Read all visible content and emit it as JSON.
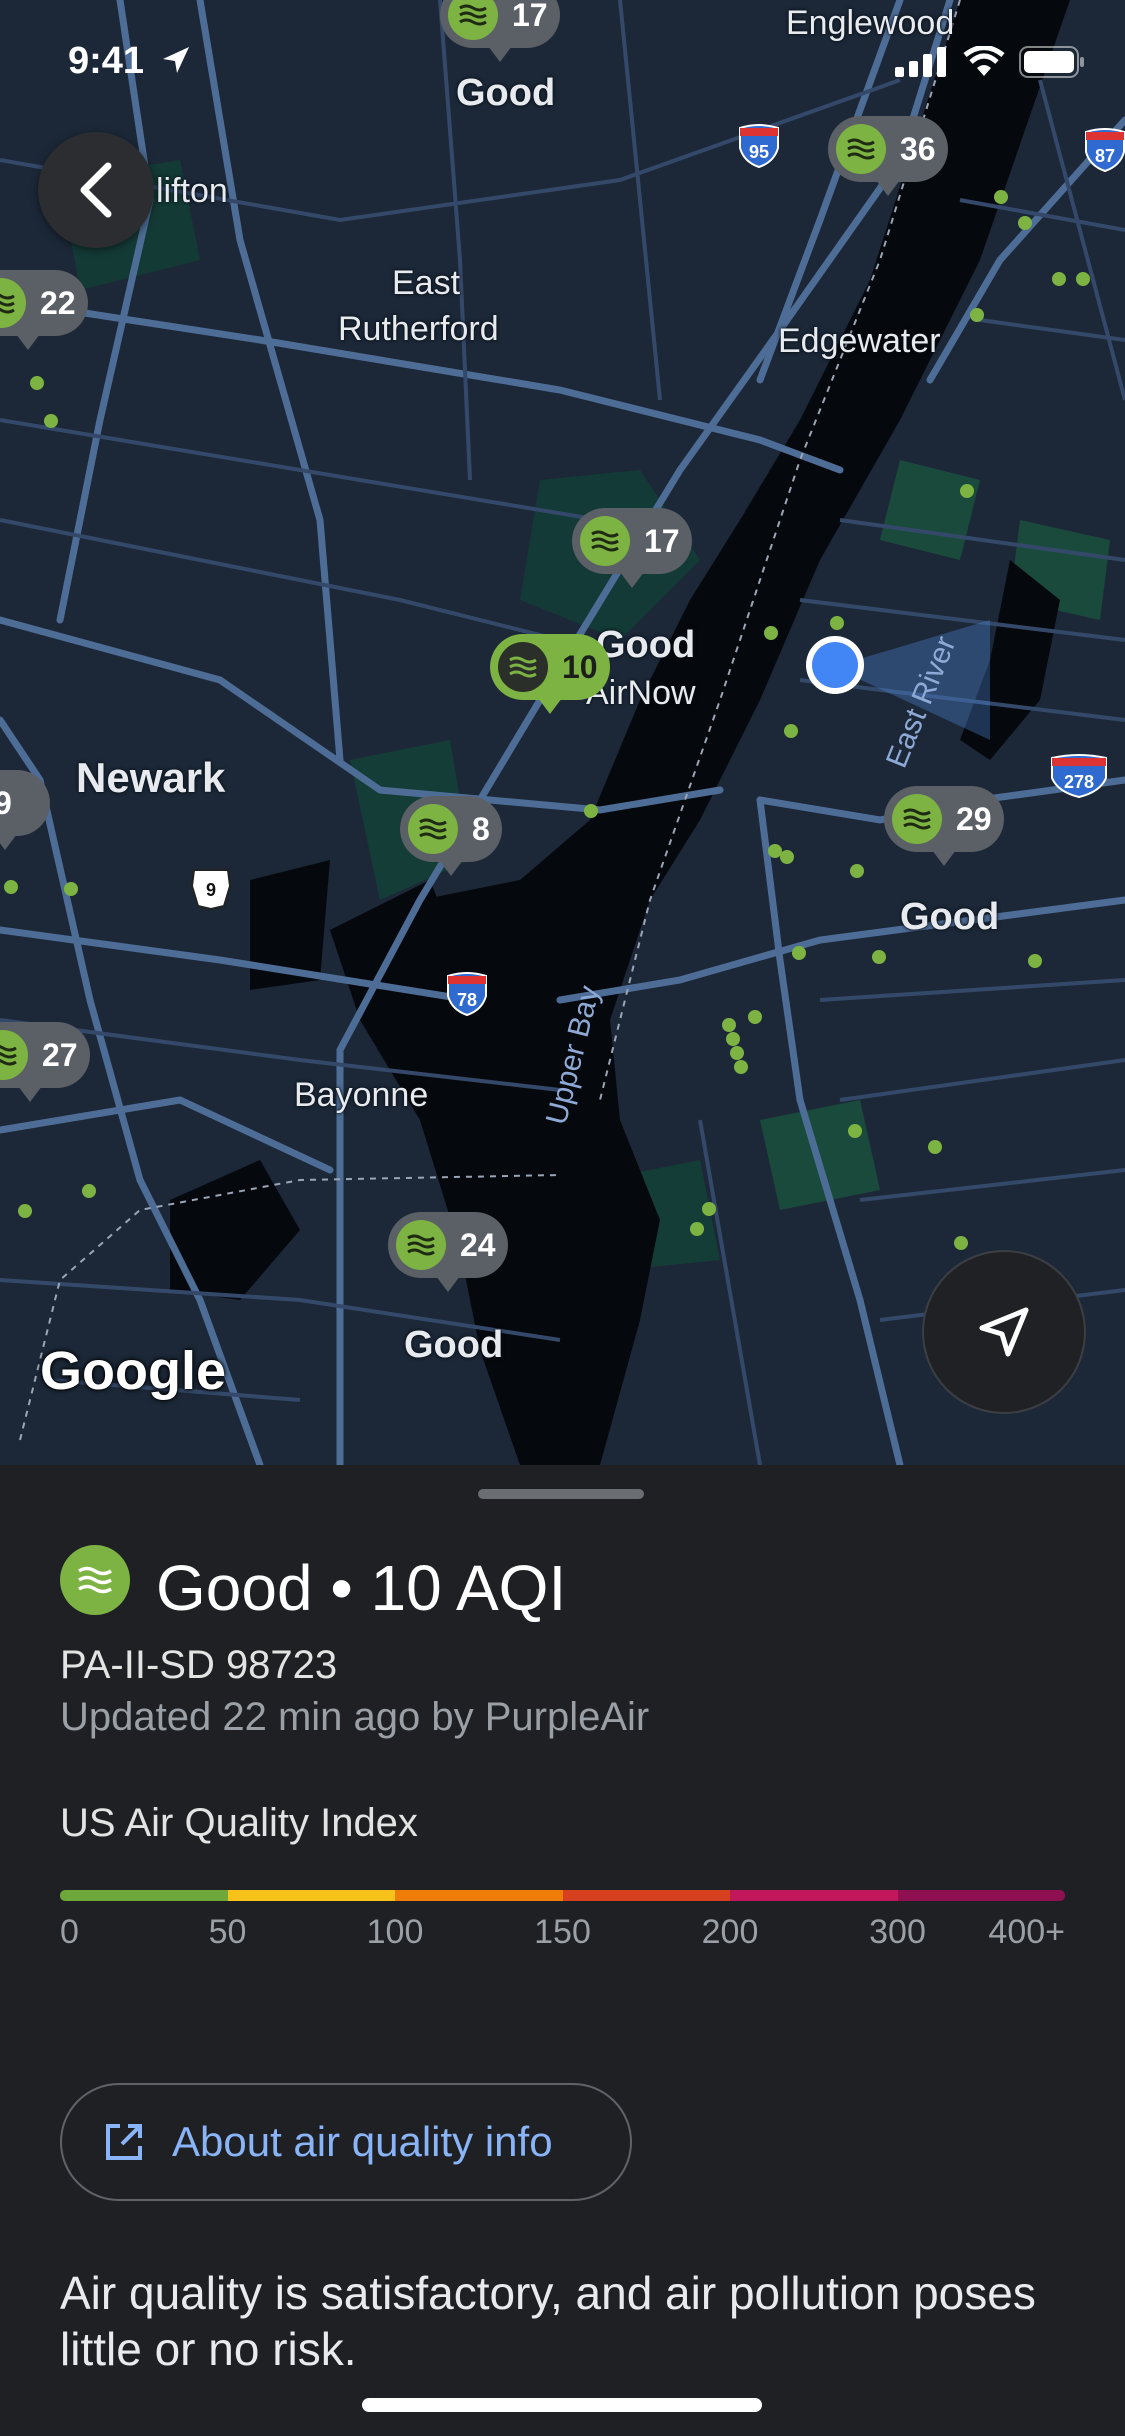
{
  "status_bar": {
    "time": "9:41"
  },
  "map": {
    "places": {
      "englewood": "Englewood",
      "clifton": "lifton",
      "east_rutherford_1": "East",
      "east_rutherford_2": "Rutherford",
      "edgewater": "Edgewater",
      "newark": "Newark",
      "bayonne": "Bayonne",
      "upper_bay": "Upper Bay",
      "east_river": "East River",
      "good_top": "Good",
      "good_center": "Good",
      "air_now": "AirNow",
      "good_right": "Good",
      "good_bottom": "Good"
    },
    "highways": {
      "i95": "95",
      "i87": "87",
      "i278": "278",
      "i78": "78",
      "us9": "9"
    },
    "pins": {
      "p17_top": "17",
      "p36": "36",
      "p22": "22",
      "p17": "17",
      "p10": "10",
      "p9": "9",
      "p8": "8",
      "p29": "29",
      "p27": "27",
      "p24": "24"
    },
    "logo": "Google"
  },
  "sheet": {
    "title": "Good • 10 AQI",
    "station_id": "PA-II-SD 98723",
    "updated": "Updated 22 min ago by PurpleAir",
    "index_label": "US Air Quality Index",
    "scale_ticks": [
      "0",
      "50",
      "100",
      "150",
      "200",
      "300",
      "400+"
    ],
    "scale_colors": [
      "#6fa83a",
      "#f7c21a",
      "#f07d0a",
      "#d7401e",
      "#c2185b",
      "#8e1050"
    ],
    "about_label": "About air quality info",
    "description": "Air quality is satisfactory, and air pollution poses little or no risk."
  }
}
